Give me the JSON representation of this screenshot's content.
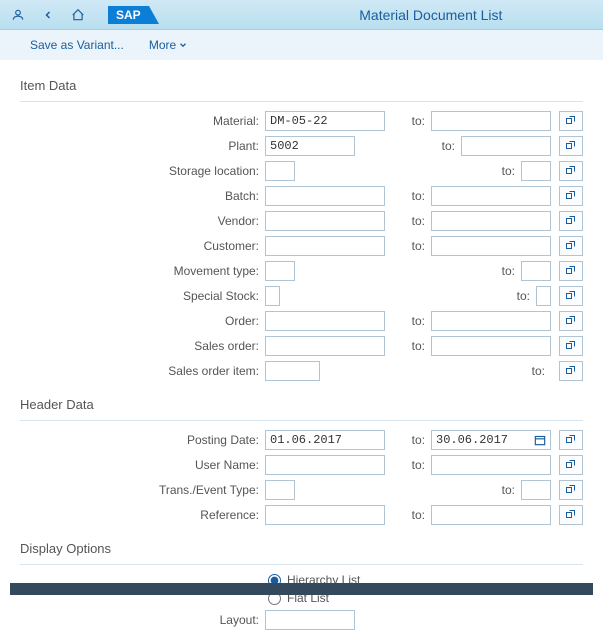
{
  "header": {
    "title": "Material Document List",
    "sap_logo": "SAP"
  },
  "toolbar": {
    "save_variant": "Save as Variant...",
    "more": "More"
  },
  "sections": {
    "item_data": {
      "title": "Item Data",
      "fields": {
        "material": {
          "label": "Material:",
          "from": "DM-05-22",
          "to": ""
        },
        "plant": {
          "label": "Plant:",
          "from": "5002",
          "to": ""
        },
        "storage_location": {
          "label": "Storage location:",
          "from": "",
          "to": ""
        },
        "batch": {
          "label": "Batch:",
          "from": "",
          "to": ""
        },
        "vendor": {
          "label": "Vendor:",
          "from": "",
          "to": ""
        },
        "customer": {
          "label": "Customer:",
          "from": "",
          "to": ""
        },
        "movement_type": {
          "label": "Movement type:",
          "from": "",
          "to": ""
        },
        "special_stock": {
          "label": "Special Stock:",
          "from": "",
          "to": ""
        },
        "order": {
          "label": "Order:",
          "from": "",
          "to": ""
        },
        "sales_order": {
          "label": "Sales order:",
          "from": "",
          "to": ""
        },
        "sales_order_item": {
          "label": "Sales order item:",
          "from": "",
          "to": ""
        }
      }
    },
    "header_data": {
      "title": "Header Data",
      "fields": {
        "posting_date": {
          "label": "Posting Date:",
          "from": "01.06.2017",
          "to": "30.06.2017"
        },
        "user_name": {
          "label": "User Name:",
          "from": "",
          "to": ""
        },
        "trans_event_type": {
          "label": "Trans./Event Type:",
          "from": "",
          "to": ""
        },
        "reference": {
          "label": "Reference:",
          "from": "",
          "to": ""
        }
      }
    },
    "display_options": {
      "title": "Display Options",
      "hierarchy_list": "Hierarchy List",
      "flat_list": "Flat List",
      "layout_label": "Layout:"
    }
  },
  "common": {
    "to_label": "to:"
  }
}
